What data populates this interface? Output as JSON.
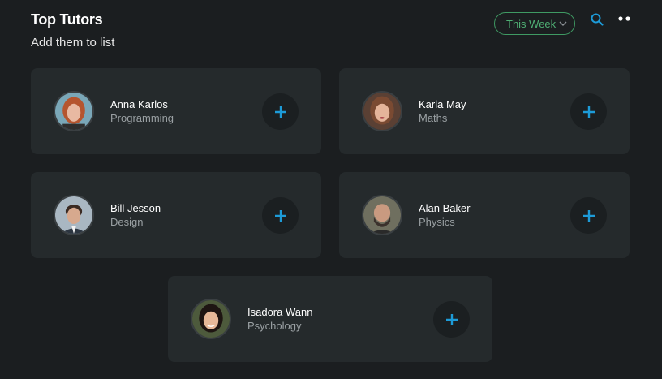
{
  "header": {
    "title": "Top Tutors",
    "subtitle": "Add them to list",
    "period_select": {
      "value": "This Week",
      "icon": "chevron-down-icon"
    },
    "search_icon": "search-icon",
    "more_icon": "more-dots-icon"
  },
  "colors": {
    "background": "#1b1e20",
    "card": "#252a2c",
    "accent_blue": "#1d9bd8",
    "accent_green": "#4faf74"
  },
  "tutors": [
    {
      "name": "Anna Karlos",
      "subject": "Programming",
      "add_icon": "plus-icon"
    },
    {
      "name": "Karla May",
      "subject": "Maths",
      "add_icon": "plus-icon"
    },
    {
      "name": "Bill Jesson",
      "subject": "Design",
      "add_icon": "plus-icon"
    },
    {
      "name": "Alan Baker",
      "subject": "Physics",
      "add_icon": "plus-icon"
    },
    {
      "name": "Isadora Wann",
      "subject": "Psychology",
      "add_icon": "plus-icon"
    }
  ]
}
